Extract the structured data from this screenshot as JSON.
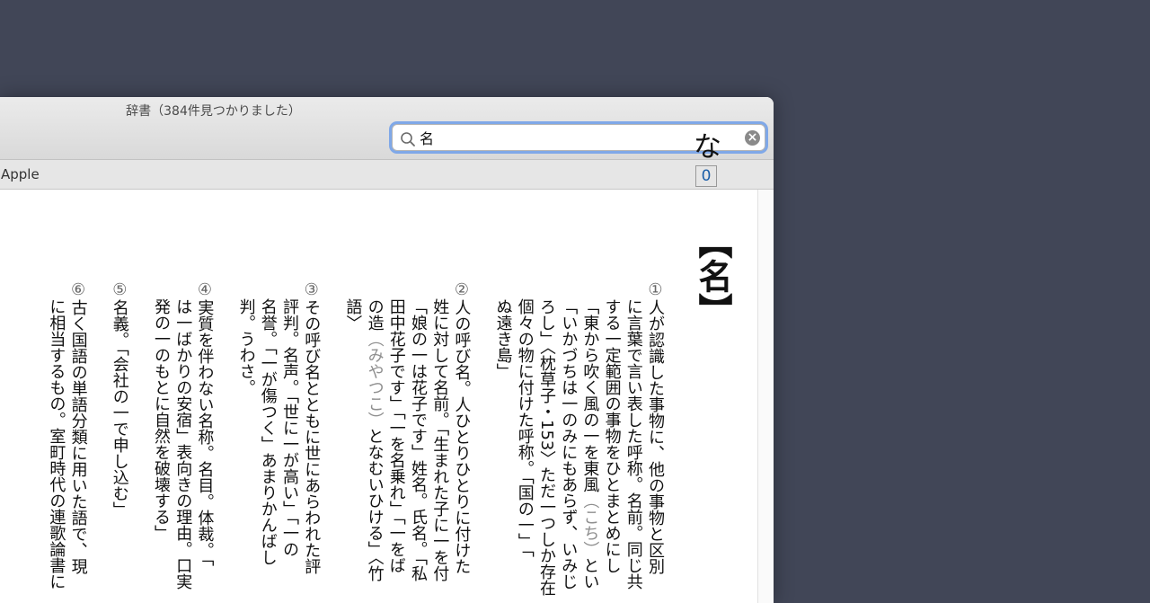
{
  "window": {
    "title": "辞書（384件見つかりました）"
  },
  "search": {
    "value": "名"
  },
  "source_tab": "Apple",
  "entry": {
    "headword": "な",
    "ref": "0",
    "kanji": "【名】",
    "columns": [
      {
        "num": "①",
        "text": "人が認識した事物に、他の事物と区別"
      },
      {
        "num": "",
        "text": "に言葉で言い表した呼称。名前。同じ共"
      },
      {
        "num": "",
        "text": "する一定範囲の事物をひとまとめにし"
      },
      {
        "num": "",
        "text": "「東から吹く風の一を東風",
        "gray": "（こち）",
        "tail": "とい"
      },
      {
        "num": "",
        "text": "「いかづちは一のみにもあらず、いみじ"
      },
      {
        "num": "",
        "text": "ろし」〈枕草子・153〉ただ一つしか存在"
      },
      {
        "num": "",
        "text": "個々の物に付けた呼称。「国の一」「"
      },
      {
        "num": "",
        "text": "ぬ遠き島」"
      },
      {
        "num": "②",
        "text": "人の呼び名。人ひとりひとりに付けた"
      },
      {
        "num": "",
        "text": "姓に対して名前。「生まれた子に一を付"
      },
      {
        "num": "",
        "text": "「娘の一は花子です」姓名。氏名。「私"
      },
      {
        "num": "",
        "text": "田中花子です」「一を名乗れ」「一をば"
      },
      {
        "num": "",
        "text": "の造",
        "gray": "（みやつこ）",
        "tail": "となむいひける」〈竹"
      },
      {
        "num": "",
        "text": "語〉"
      },
      {
        "num": "③",
        "text": "その呼び名とともに世にあらわれた評"
      },
      {
        "num": "",
        "text": "評判。名声。「世に一が高い」「一の"
      },
      {
        "num": "",
        "text": "名誉。「一が傷つく」あまりかんばし"
      },
      {
        "num": "",
        "text": "判。うわさ。"
      },
      {
        "num": "④",
        "text": "実質を伴わない名称。名目。体裁。「"
      },
      {
        "num": "",
        "text": "は一ばかりの安宿」表向きの理由。口実"
      },
      {
        "num": "",
        "text": "発の一のもとに自然を破壊する」"
      },
      {
        "num": "⑤",
        "text": "名義。「会社の一で申し込む」"
      },
      {
        "num": "⑥",
        "text": "古く国語の単語分類に用いた語で、現"
      },
      {
        "num": "",
        "text": "に相当するもの。室町時代の連歌論書に"
      }
    ]
  },
  "colors": {
    "desktop": "#414657",
    "focus_ring": "#7fa8e8",
    "link_blue": "#1a5ea8"
  }
}
